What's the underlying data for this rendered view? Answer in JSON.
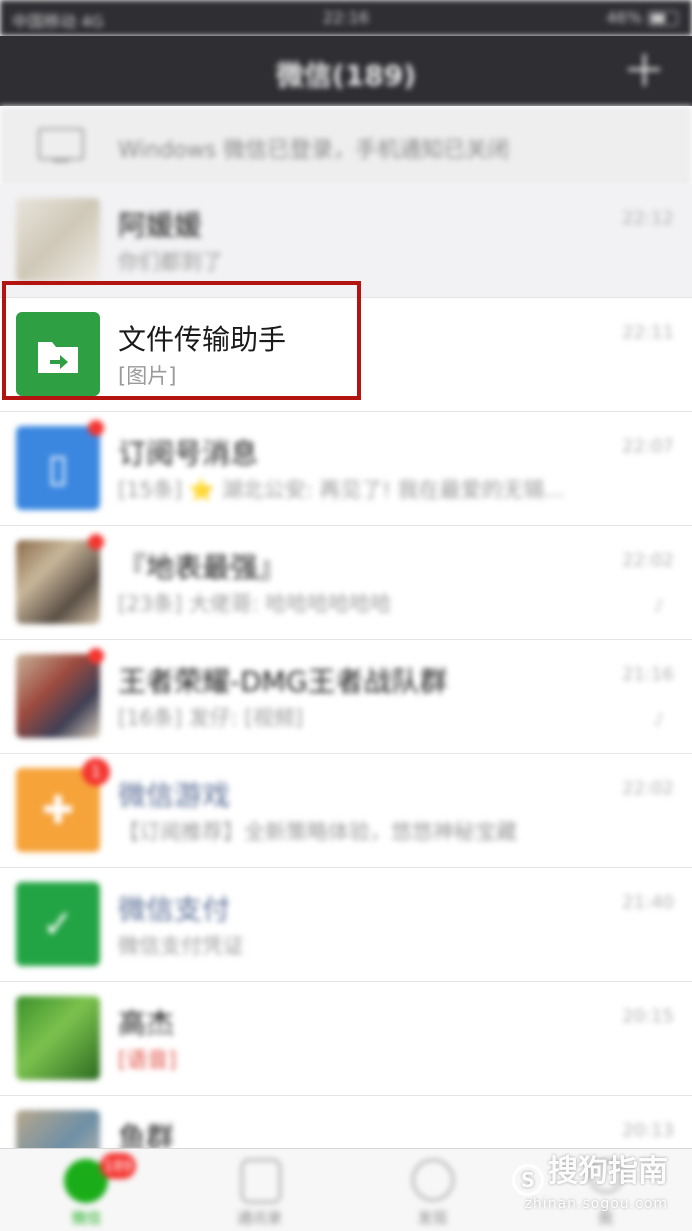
{
  "status_bar": {
    "carrier": "中国移动 4G",
    "time": "22:16",
    "battery": "46%"
  },
  "navbar": {
    "title": "微信(189)"
  },
  "notice": {
    "text": "Windows 微信已登录，手机通知已关闭"
  },
  "chats": [
    {
      "name": "阿媛媛",
      "preview": "你们都到了",
      "time": "22:12"
    },
    {
      "name": "文件传输助手",
      "preview": "[图片]",
      "time": "22:11"
    },
    {
      "name": "订阅号消息",
      "preview": "[15条] ⭐ 湖北公安: 再见了! 我在最爱的无锡...",
      "time": "22:07",
      "unread_dot": true
    },
    {
      "name": "『地表最强』",
      "preview": "[23条] 大佬哥: 哈哈哈哈哈哈",
      "time": "22:02",
      "unread_dot": true,
      "muted": true
    },
    {
      "name": "王者荣耀-DMG王者战队群",
      "preview": "[16条] 发仔: [视频]",
      "time": "21:16",
      "unread_dot": true,
      "muted": true
    },
    {
      "name": "微信游戏",
      "preview": "【订阅推荐】全新策略体验，悠悠神秘宝藏",
      "time": "22:02",
      "badge": "1"
    },
    {
      "name": "微信支付",
      "preview": "微信支付凭证",
      "time": "21:40"
    },
    {
      "name": "高杰",
      "preview_tag": "[语音]",
      "time": "20:15"
    },
    {
      "name": "鱼群",
      "time": "20:13"
    }
  ],
  "tabbar": {
    "tabs": [
      {
        "label": "微信",
        "badge": "189"
      },
      {
        "label": "通讯录"
      },
      {
        "label": "发现"
      },
      {
        "label": "我"
      }
    ]
  },
  "watermark": {
    "main": "搜狗指南",
    "sub": "zhinan.sogou.com"
  },
  "colors": {
    "nav_bg": "#2e2e33",
    "accent_green": "#1aad19",
    "badge_red": "#f43530",
    "highlight": "#b3140f"
  }
}
